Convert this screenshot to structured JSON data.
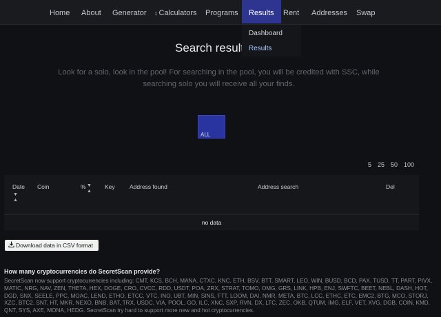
{
  "nav": {
    "home": "Home",
    "about": "About",
    "generator": "Generator",
    "calculators": "Calculators",
    "programs": "Programs",
    "results": "Results",
    "rent": "Rent",
    "addresses": "Addresses",
    "swap": "Swap"
  },
  "dropdown": {
    "dashboard": "Dashboard",
    "results": "Results"
  },
  "page": {
    "title": "Search result",
    "subtitle": "Look for a solo, look in the pool! For searching in the pool, you will be credited with SSC, while searching solo you will receive all your finds."
  },
  "filter": {
    "all_label": "ALL"
  },
  "pagination": {
    "sizes": [
      "5",
      "25",
      "50",
      "100"
    ]
  },
  "table": {
    "columns": {
      "date": "Date",
      "coin": "Coin",
      "percent": "%",
      "key": "Key",
      "address_found": "Address found",
      "address_search": "Address search",
      "del": "Del"
    },
    "empty_text": "no data"
  },
  "actions": {
    "download_csv": "Download data in CSV format"
  },
  "faq": {
    "question": "How many cryptocurrencies do SecretScan provide?",
    "answer": "SecretScan now support cryptocurrencies including: CMT, KCS, BCH, MANA, CTXC, KNC, ETH, BSV, BTT, SMART, LEO, WIN, BUSD, BCD, PAX, TUSD, TT, PART, PIVX, MATIC, NRG, NAV, ZEN, THETA, HEX, DOGE, CRO, CVCC, RDD, USDT, POA, ZRX, STRAT, TOMO, OMG, GRS, LINK, HPB, ENJ, SWFTC, BEET, NEBL, DASH, HOT, DGD, SNX, SEELE, PPC, MOAC, LEND, ETHO, ETCC, VTC, INO, UBT, MIN, SINS, FTT, LOOM, DAI, NMR, META, BTC, LCC, ETHC, ETC, EMC2, BTG, MCO, STORJ, XZC, BTC2, SNT, HT, MKR, NEXO, BNB, BAT, TRX, USDC, VIA, POOL, GO, ILC, XNC, SXP, RVN, DX, LTC, ZEC, OKB, QTUM, IMG, ELF, VET, XVG, DGB, COIN, KMD, QNT, SYS, AXE, MONA, HEDG. SecretScan try hard to support more new and hot cryptocurrencies."
  },
  "colors": {
    "background": "#101114",
    "navbar": "#1a1b1f",
    "active_accent": "#2d3591",
    "button_accent": "#2a34a0",
    "link_highlight": "#a9c8ff"
  },
  "icons": {
    "calculators": "updown-arrows-icon",
    "sort": "sort-arrows-icon",
    "download": "download-icon"
  }
}
